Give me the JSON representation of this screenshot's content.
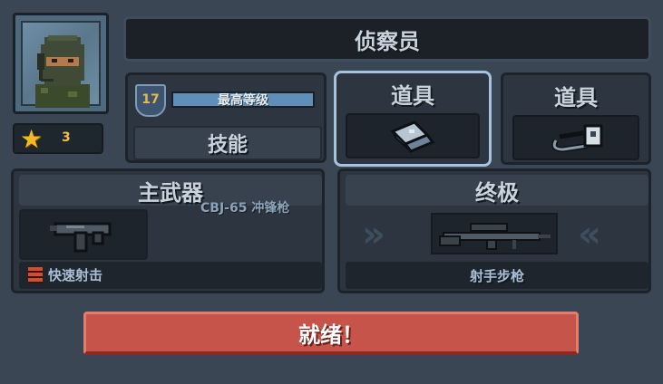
{
  "character": {
    "name": "侦察员",
    "stars": "3"
  },
  "level": {
    "number": "17",
    "status": "最高等级",
    "progress": 1.0
  },
  "skills": {
    "label": "技能"
  },
  "items": [
    {
      "label": "道具",
      "icon": "gadget-device-icon"
    },
    {
      "label": "道具",
      "icon": "cable-device-icon"
    }
  ],
  "primary_weapon": {
    "title": "主武器",
    "name": "CBJ-65 冲锋枪",
    "trait": "快速射击",
    "icon": "smg-icon"
  },
  "ultimate": {
    "title": "终极",
    "name": "射手步枪",
    "icon": "marksman-rifle-icon"
  },
  "ready_button": {
    "label": "就绪！"
  },
  "colors": {
    "background": "#3a4654",
    "panel": "#2c3540",
    "selected_outline": "#a7c2dc",
    "ready_red": "#c6544a",
    "star_gold": "#f4b826"
  }
}
